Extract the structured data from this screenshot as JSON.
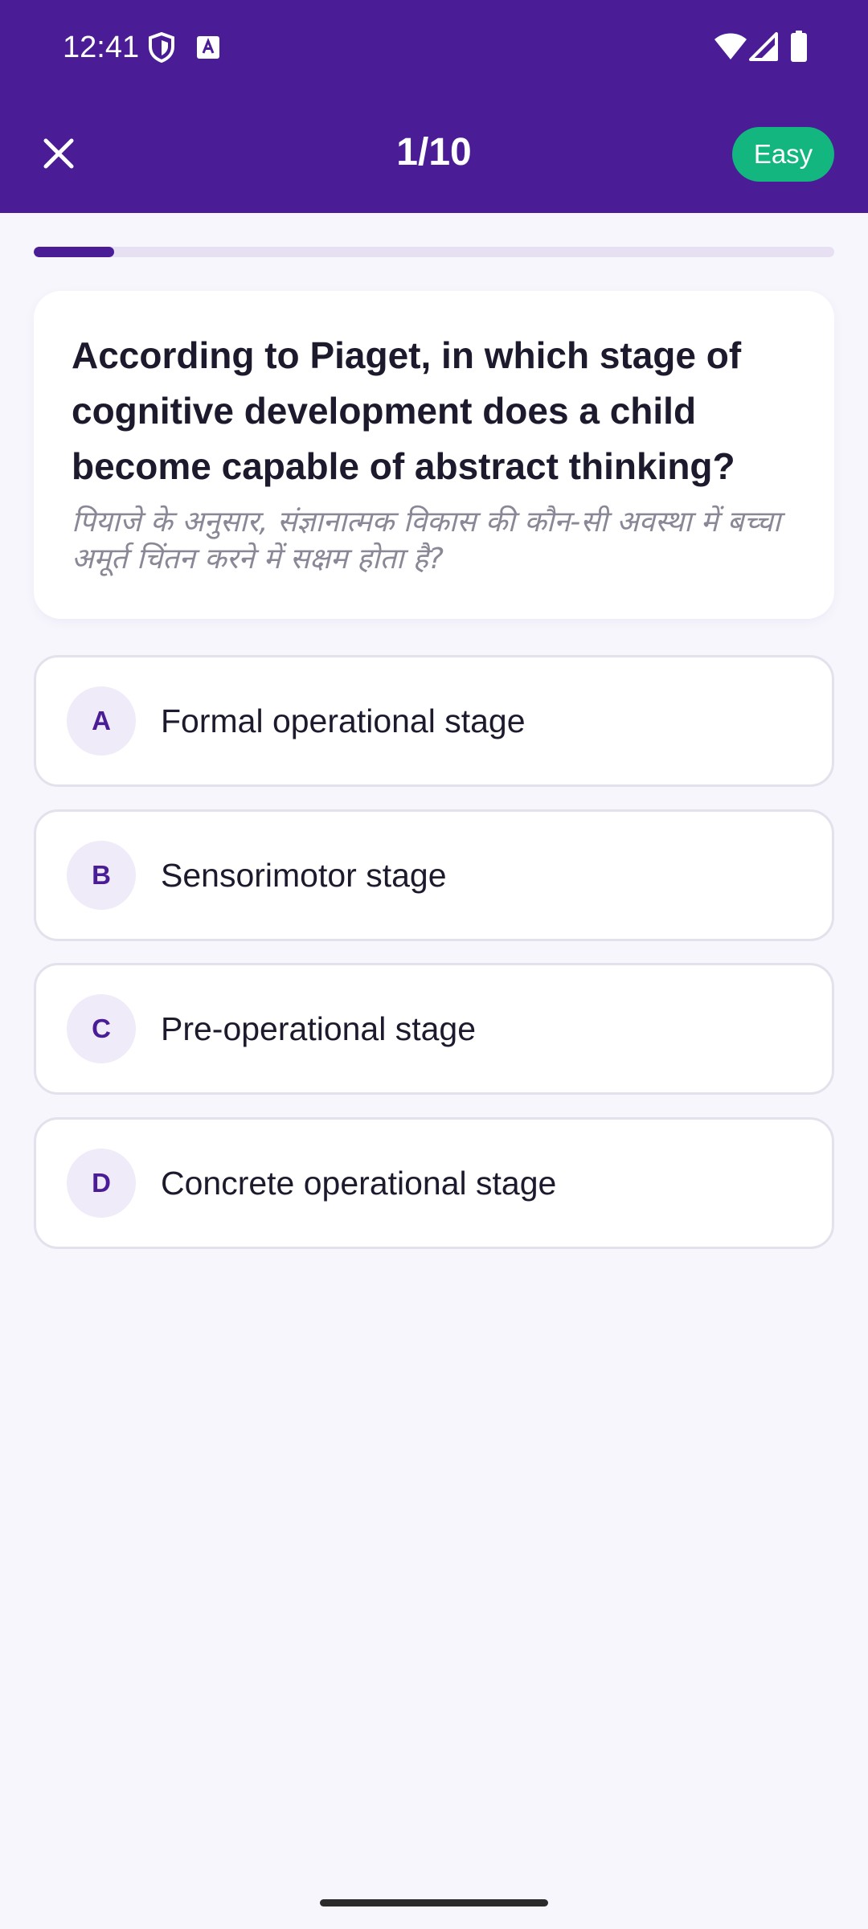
{
  "status_bar": {
    "time": "12:41",
    "icons": [
      "shield-icon",
      "text-a-icon",
      "wifi-icon",
      "signal-icon",
      "battery-icon"
    ]
  },
  "header": {
    "close_icon": "close-icon",
    "counter": "1/10",
    "difficulty": "Easy"
  },
  "progress": {
    "current": 1,
    "total": 10,
    "fraction": 0.1
  },
  "question": {
    "text_en": "According to Piaget, in which stage of cognitive development does a child become capable of abstract thinking?",
    "text_hi": "पियाजे के अनुसार, संज्ञानात्मक विकास की कौन-सी अवस्था में बच्चा अमूर्त चिंतन करने में सक्षम होता है?"
  },
  "options": [
    {
      "letter": "A",
      "text": "Formal operational stage"
    },
    {
      "letter": "B",
      "text": "Sensorimotor stage"
    },
    {
      "letter": "C",
      "text": "Pre-operational stage"
    },
    {
      "letter": "D",
      "text": "Concrete operational stage"
    }
  ],
  "colors": {
    "primary": "#4A1D96",
    "success": "#13B67E",
    "background": "#F7F6FC",
    "text": "#1E1A2E",
    "muted": "#8A8796",
    "progress_track": "#E6E0F2"
  }
}
